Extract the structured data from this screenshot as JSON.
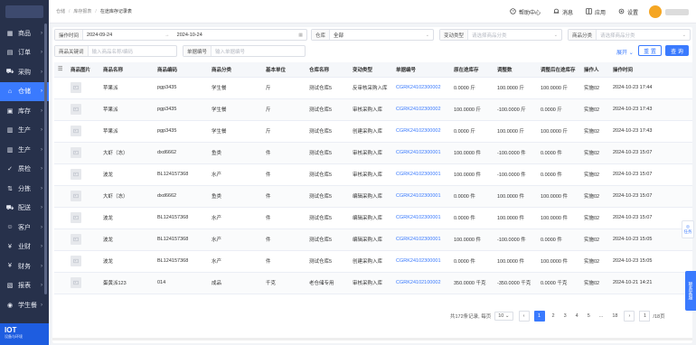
{
  "sidebar": {
    "items": [
      {
        "label": "商品",
        "icon": "grid-icon"
      },
      {
        "label": "订单",
        "icon": "document-icon"
      },
      {
        "label": "采购",
        "icon": "cart-icon"
      },
      {
        "label": "仓储",
        "icon": "warehouse-icon",
        "active": true
      },
      {
        "label": "库存",
        "icon": "box-icon"
      },
      {
        "label": "生产",
        "icon": "factory-icon"
      },
      {
        "label": "生产",
        "icon": "factory-icon"
      },
      {
        "label": "质检",
        "icon": "check-icon"
      },
      {
        "label": "分拣",
        "icon": "sort-icon"
      },
      {
        "label": "配送",
        "icon": "truck-icon"
      },
      {
        "label": "客户",
        "icon": "user-icon"
      },
      {
        "label": "业财",
        "icon": "finance-icon"
      },
      {
        "label": "财务",
        "icon": "money-icon"
      },
      {
        "label": "报表",
        "icon": "chart-icon"
      },
      {
        "label": "学生餐",
        "icon": "meal-icon"
      }
    ],
    "footer_title": "IOT",
    "footer_sub": "设备与环境"
  },
  "header": {
    "breadcrumb": [
      "仓储",
      "库存报表",
      "在途库存记录表"
    ],
    "help": "帮助中心",
    "messages": "消息",
    "apps": "应用",
    "settings": "设置"
  },
  "filters": {
    "op_time_label": "操作时间",
    "date_start": "2024-09-24",
    "date_sep": "→",
    "date_end": "2024-10-24",
    "warehouse_label": "仓库",
    "warehouse_value": "全部",
    "change_type_label": "变动类型",
    "change_type_ph": "请选择商品分类",
    "category_label": "商品分类",
    "category_ph": "请选择商品分类",
    "keyword_label": "商品关键词",
    "keyword_ph": "输入商品名称/编码",
    "doc_no_label": "单据编号",
    "doc_no_ph": "输入单据编号",
    "expand": "展开",
    "reset": "重 置",
    "query": "查 询"
  },
  "table": {
    "columns": [
      "商品图片",
      "商品名称",
      "商品编码",
      "商品分类",
      "基本单位",
      "仓库名称",
      "变动类型",
      "单据编号",
      "原在途库存",
      "调整数",
      "调整后在途库存",
      "操作人",
      "操作时间"
    ],
    "rows": [
      [
        "",
        "苹果派",
        "pgp3435",
        "学生餐",
        "斤",
        "测试仓库5",
        "反审核采购入库",
        "CGRK24102300002",
        "0.0000 斤",
        "100.0000 斤",
        "100.0000 斤",
        "实施02",
        "2024-10-23 17:44"
      ],
      [
        "",
        "苹果派",
        "pgp3435",
        "学生餐",
        "斤",
        "测试仓库5",
        "审核采购入库",
        "CGRK24102300002",
        "100.0000 斤",
        "-100.0000 斤",
        "0.0000 斤",
        "实施02",
        "2024-10-23 17:43"
      ],
      [
        "",
        "苹果派",
        "pgp3435",
        "学生餐",
        "斤",
        "测试仓库5",
        "创建采购入库",
        "CGRK24102300002",
        "0.0000 斤",
        "100.0000 斤",
        "100.0000 斤",
        "实施02",
        "2024-10-23 17:43"
      ],
      [
        "",
        "大虾（冻）",
        "dxd6662",
        "鱼类",
        "件",
        "测试仓库5",
        "审核采购入库",
        "CGRK24102300001",
        "100.0000 件",
        "-100.0000 件",
        "0.0000 件",
        "实施02",
        "2024-10-23 15:07"
      ],
      [
        "",
        "波龙",
        "BL124157368",
        "水产",
        "件",
        "测试仓库5",
        "审核采购入库",
        "CGRK24102300001",
        "100.0000 件",
        "-100.0000 件",
        "0.0000 件",
        "实施02",
        "2024-10-23 15:07"
      ],
      [
        "",
        "大虾（冻）",
        "dxd6662",
        "鱼类",
        "件",
        "测试仓库5",
        "编辑采购入库",
        "CGRK24102300001",
        "0.0000 件",
        "100.0000 件",
        "100.0000 件",
        "实施02",
        "2024-10-23 15:07"
      ],
      [
        "",
        "波龙",
        "BL124157368",
        "水产",
        "件",
        "测试仓库5",
        "编辑采购入库",
        "CGRK24102300001",
        "0.0000 件",
        "100.0000 件",
        "100.0000 件",
        "实施02",
        "2024-10-23 15:07"
      ],
      [
        "",
        "波龙",
        "BL124157368",
        "水产",
        "件",
        "测试仓库5",
        "编辑采购入库",
        "CGRK24102300001",
        "100.0000 件",
        "-100.0000 件",
        "0.0000 件",
        "实施02",
        "2024-10-23 15:05"
      ],
      [
        "",
        "波龙",
        "BL124157368",
        "水产",
        "件",
        "测试仓库5",
        "创建采购入库",
        "CGRK24102300001",
        "0.0000 件",
        "100.0000 件",
        "100.0000 件",
        "实施02",
        "2024-10-23 15:05"
      ],
      [
        "",
        "蛋黄派123",
        "014",
        "成品",
        "千克",
        "老仓储专用",
        "审核采购入库",
        "CGRK24102100002",
        "350.0000 千克",
        "-350.0000 千克",
        "0.0000 千克",
        "实施02",
        "2024-10-21 14:21"
      ]
    ]
  },
  "pagination": {
    "total": "共172条记录, 每页",
    "page_size": "10",
    "pages": [
      "1",
      "2",
      "3",
      "4",
      "5",
      "...",
      "18"
    ],
    "jump_value": "1",
    "total_pages": "/18页"
  },
  "floats": {
    "task": "任务",
    "contact": "联系客服"
  },
  "colors": {
    "accent": "#3a7afe",
    "sidebar": "#27314b"
  }
}
